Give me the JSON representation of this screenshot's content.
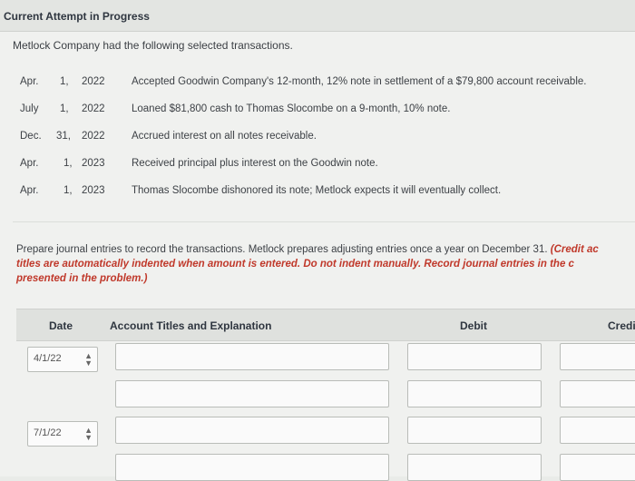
{
  "header": {
    "title": "Current Attempt in Progress"
  },
  "intro": "Metlock Company had the following selected transactions.",
  "transactions": [
    {
      "month": "Apr.",
      "day": "1,",
      "year": "2022",
      "desc": "Accepted Goodwin Company's 12-month, 12% note in settlement of a $79,800 account receivable."
    },
    {
      "month": "July",
      "day": "1,",
      "year": "2022",
      "desc": "Loaned $81,800 cash to Thomas Slocombe on a 9-month, 10% note."
    },
    {
      "month": "Dec.",
      "day": "31,",
      "year": "2022",
      "desc": "Accrued interest on all notes receivable."
    },
    {
      "month": "Apr.",
      "day": "1,",
      "year": "2023",
      "desc": "Received principal plus interest on the Goodwin note."
    },
    {
      "month": "Apr.",
      "day": "1,",
      "year": "2023",
      "desc": "Thomas Slocombe dishonored its note; Metlock expects it will eventually collect."
    }
  ],
  "instructions": {
    "normal": "Prepare journal entries to record the transactions. Metlock prepares adjusting entries once a year on December 31.",
    "red_line1": "(Credit ac",
    "red_line2": "titles are automatically indented when amount is entered. Do not indent manually. Record journal entries in the c",
    "red_line3": "presented in the problem.)"
  },
  "table": {
    "headers": {
      "date": "Date",
      "account": "Account Titles and Explanation",
      "debit": "Debit",
      "credit": "Credi"
    },
    "rows": [
      {
        "date": "4/1/22"
      },
      {
        "date": "7/1/22"
      }
    ]
  }
}
